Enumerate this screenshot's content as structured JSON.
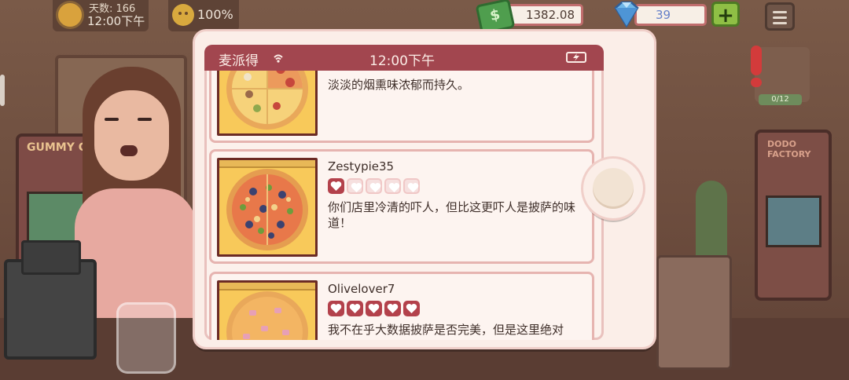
{
  "hud": {
    "days_label": "天数: 166",
    "time": "12:00下午",
    "mood_percent": "100%",
    "money": "1382.08",
    "money_icon_glyph": "$",
    "gems": "39",
    "add_gems_label": "+",
    "icons": [
      "sun-icon",
      "mood-face-icon",
      "money-icon",
      "diamond-icon",
      "menu-icon"
    ]
  },
  "background": {
    "arcade_left_sign": "GUMMY G",
    "arcade_right_sign": "DODO FACTORY",
    "shelf_tag": "0/12"
  },
  "phone": {
    "status_bar": {
      "carrier": "麦派得",
      "time": "12:00下午"
    },
    "reviews": [
      {
        "reviewer": "",
        "rating": 0,
        "text": "淡淡的烟熏味浓郁而持久。",
        "pizza_style": "mixed-toppings"
      },
      {
        "reviewer": "Zestypie35",
        "rating": 1,
        "max_rating": 5,
        "text": "你们店里冷清的吓人，但比这更吓人是披萨的味道！",
        "pizza_style": "veggie-olive"
      },
      {
        "reviewer": "Olivelover7",
        "rating": 5,
        "max_rating": 5,
        "text": "我不在乎大数据披萨是否完美，但是这里绝对",
        "pizza_style": "cheese-ham"
      }
    ]
  },
  "colors": {
    "status_bar": "#a2464f",
    "heart_on": "#b3414b",
    "heart_off": "#f6e0df",
    "pizza_box": "#f8c95a"
  }
}
